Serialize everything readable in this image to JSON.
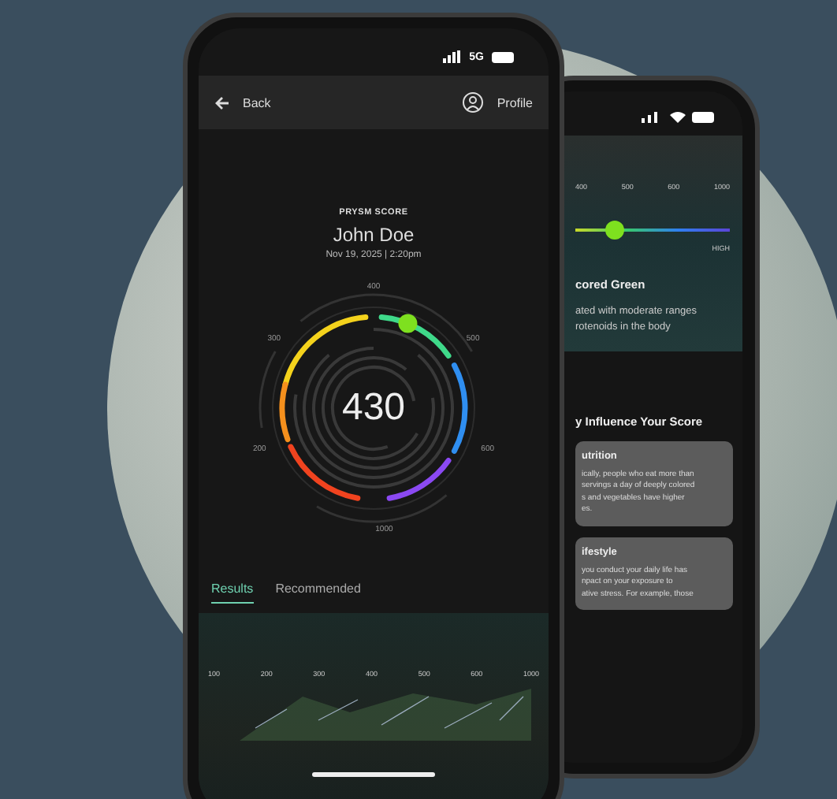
{
  "front_phone": {
    "status_bar": {
      "network": "5G"
    },
    "header": {
      "back": "Back",
      "profile": "Profile"
    },
    "score": {
      "eyebrow": "PRYSM SCORE",
      "name": "John Doe",
      "date": "Nov 19, 2025 | 2:20pm",
      "value": "430",
      "ticks": [
        "400",
        "500",
        "600",
        "1000",
        "200",
        "300"
      ]
    },
    "tabs": [
      {
        "label": "Results",
        "selected": true
      },
      {
        "label": "Recommended",
        "selected": false
      }
    ],
    "scale": [
      "100",
      "200",
      "300",
      "400",
      "500",
      "600",
      "1000"
    ]
  },
  "back_phone": {
    "scale": [
      "400",
      "500",
      "600",
      "1000"
    ],
    "level": 0.25,
    "high_label": "HIGH",
    "heading": "cored Green",
    "description": "ated with moderate ranges\nrotenoids in the body",
    "section_title": "y Influence Your Score",
    "cards": [
      {
        "title": "utrition",
        "text": "ically, people who eat more than\nservings a day of deeply colored\ns and vegetables have higher\nes."
      },
      {
        "title": "ifestyle",
        "text": "you conduct your daily life has\nnpact on your exposure to\native stress. For example, those"
      }
    ]
  }
}
